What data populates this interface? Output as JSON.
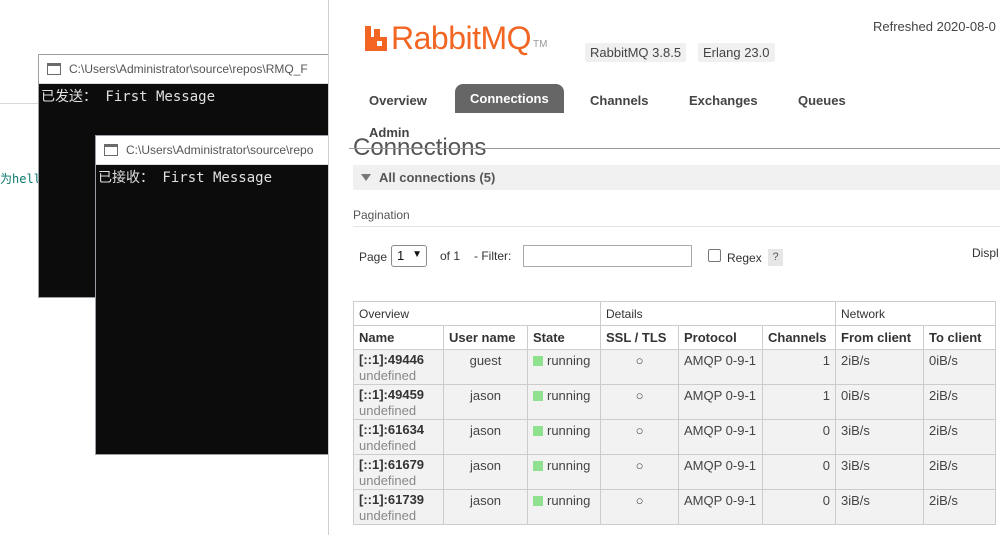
{
  "ide": {
    "snippet": "为hell"
  },
  "consoles": [
    {
      "title": "C:\\Users\\Administrator\\source\\repos\\RMQ_F",
      "output": "已发送： First Message"
    },
    {
      "title": "C:\\Users\\Administrator\\source\\repo",
      "output": "已接收： First Message"
    }
  ],
  "rabbitmq": {
    "logo_text": "RabbitMQ",
    "logo_tm": "TM",
    "version": "RabbitMQ 3.8.5",
    "erlang": "Erlang 23.0",
    "refreshed": "Refreshed 2020-08-0",
    "tabs": [
      "Overview",
      "Connections",
      "Channels",
      "Exchanges",
      "Queues",
      "Admin"
    ],
    "active_tab": "Connections",
    "page_title": "Connections",
    "section_label": "All connections (5)",
    "pagination": {
      "label": "Pagination",
      "page_label": "Page",
      "page_value": "1",
      "of_label": "of 1",
      "filter_label": "- Filter:",
      "filter_value": "",
      "regex_label": "Regex",
      "help": "?",
      "display_label": "Displ"
    },
    "table": {
      "groups": [
        "Overview",
        "Details",
        "Network"
      ],
      "columns": [
        "Name",
        "User name",
        "State",
        "SSL / TLS",
        "Protocol",
        "Channels",
        "From client",
        "To client"
      ],
      "rows": [
        {
          "name": "[::1]:49446",
          "sub": "undefined",
          "user": "guest",
          "state": "running",
          "ssl": "○",
          "protocol": "AMQP 0-9-1",
          "channels": "1",
          "from": "2iB/s",
          "to": "0iB/s"
        },
        {
          "name": "[::1]:49459",
          "sub": "undefined",
          "user": "jason",
          "state": "running",
          "ssl": "○",
          "protocol": "AMQP 0-9-1",
          "channels": "1",
          "from": "0iB/s",
          "to": "2iB/s"
        },
        {
          "name": "[::1]:61634",
          "sub": "undefined",
          "user": "jason",
          "state": "running",
          "ssl": "○",
          "protocol": "AMQP 0-9-1",
          "channels": "0",
          "from": "3iB/s",
          "to": "2iB/s"
        },
        {
          "name": "[::1]:61679",
          "sub": "undefined",
          "user": "jason",
          "state": "running",
          "ssl": "○",
          "protocol": "AMQP 0-9-1",
          "channels": "0",
          "from": "3iB/s",
          "to": "2iB/s"
        },
        {
          "name": "[::1]:61739",
          "sub": "undefined",
          "user": "jason",
          "state": "running",
          "ssl": "○",
          "protocol": "AMQP 0-9-1",
          "channels": "0",
          "from": "3iB/s",
          "to": "2iB/s"
        }
      ]
    }
  },
  "colors": {
    "brand": "#f26522",
    "active_tab": "#666666",
    "running": "#8fe08f",
    "row_bg": "#f2f2f2"
  }
}
